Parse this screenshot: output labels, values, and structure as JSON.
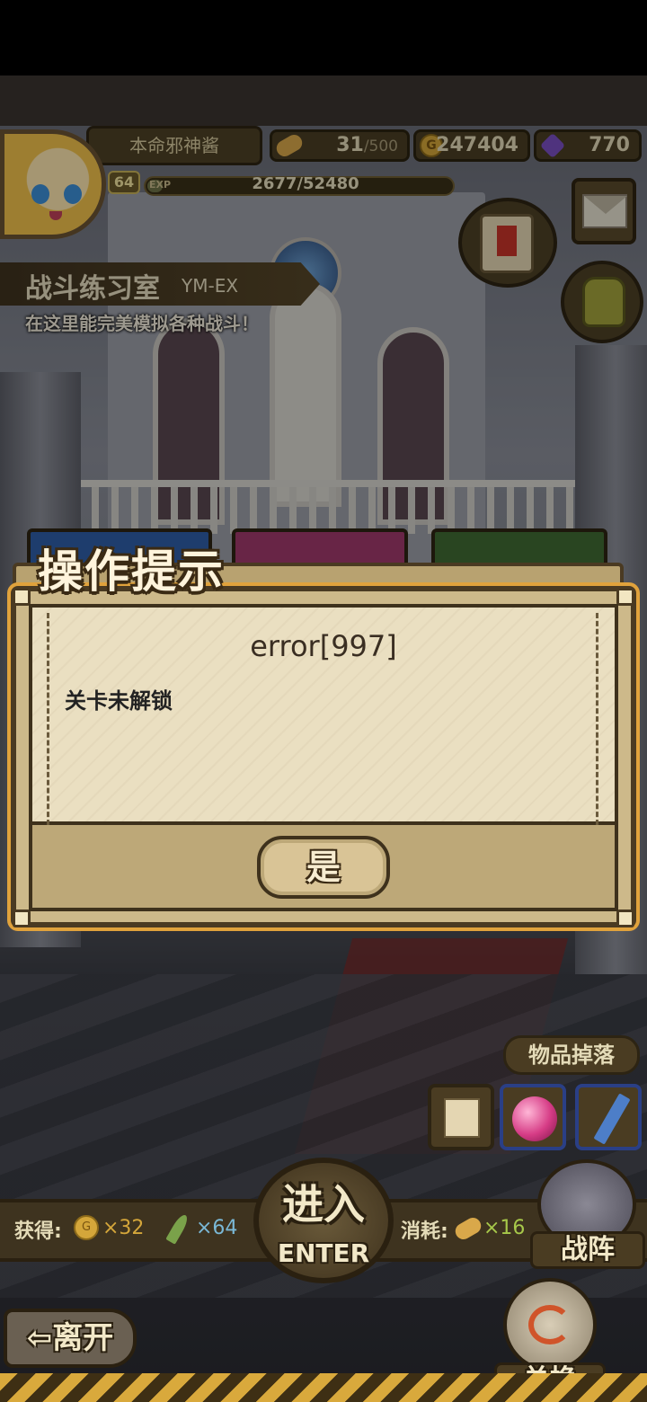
{
  "player": {
    "name": "本命邪神酱",
    "level": "64",
    "exp_label": "EXP",
    "exp_text": "2677/52480",
    "exp_fraction": 0.051
  },
  "resources": {
    "stamina": "31",
    "stamina_max": "/500",
    "gold_symbol": "G",
    "gold": "247404",
    "gems": "770"
  },
  "stage": {
    "title": "战斗练习室",
    "code": "YM-EX",
    "description": "在这里能完美模拟各种战斗！"
  },
  "dialog": {
    "title": "操作提示",
    "error_code": "error[997]",
    "message": "关卡未解锁",
    "confirm_label": "是"
  },
  "drops": {
    "label": "物品掉落",
    "items": [
      "scroll-icon",
      "orb-icon",
      "crayon-icon"
    ]
  },
  "rewards": {
    "gain_label": "获得:",
    "gold_symbol": "G",
    "gold_amount": "×32",
    "feather_amount": "×64",
    "cost_label": "消耗:",
    "bread_amount": "×16"
  },
  "buttons": {
    "enter_main": "进入",
    "enter_sub": "ENTER",
    "formation": "战阵",
    "leave": "⇦离开",
    "exchange": "兑换"
  },
  "colors": {
    "dialog_border": "#4a3a22",
    "dialog_glow": "#e0a23c",
    "parchment": "#eadfc1",
    "gold": "#d4a63a",
    "gem": "#7a4fc2"
  }
}
